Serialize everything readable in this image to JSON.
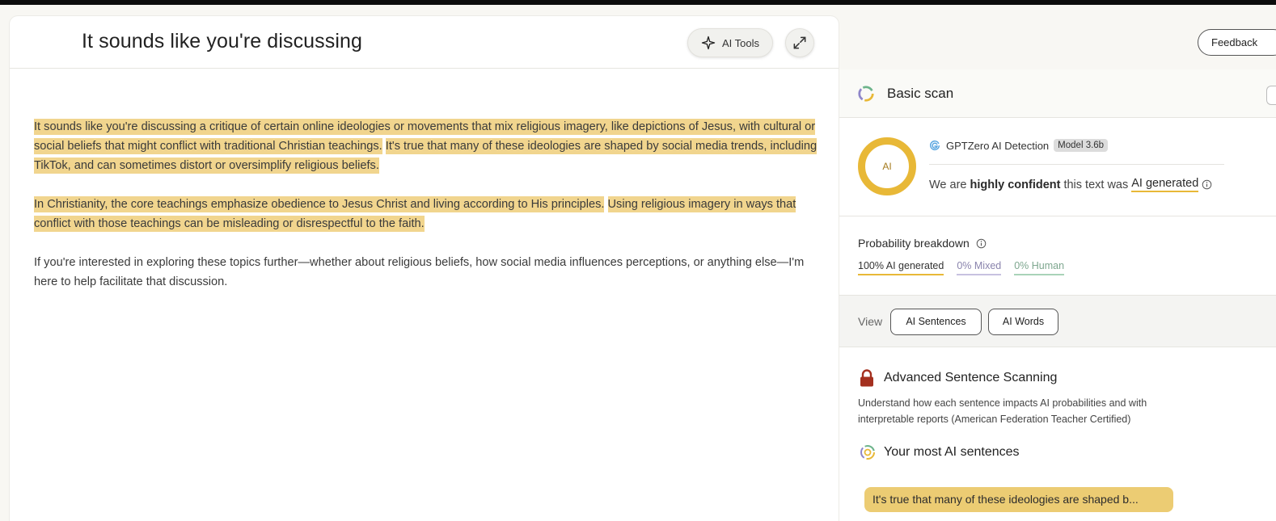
{
  "editor": {
    "title": "It sounds like you're discussing",
    "ai_tools_label": "AI Tools",
    "paragraphs": [
      {
        "s1": "It sounds like you're discussing a critique of certain online ideologies or movements that mix religious imagery, like depictions of Jesus, with cultural or social beliefs that might conflict with traditional Christian teachings.",
        "s2": "It's true that many of these ideologies are shaped by social media trends, including TikTok, and can sometimes distort or oversimplify religious beliefs."
      },
      {
        "s1": "In Christianity, the core teachings emphasize obedience to Jesus Christ and living according to His principles.",
        "s2": "Using religious imagery in ways that conflict with those teachings can be misleading or disrespectful to the faith."
      },
      {
        "s1": "If you're interested in exploring these topics further—whether about religious beliefs, how social media influences perceptions, or anything else—I'm here to help facilitate that discussion."
      }
    ]
  },
  "panel": {
    "feedback_label": "Feedback",
    "scan_title": "Basic scan",
    "ring_label": "AI",
    "detector_name": "GPTZero AI Detection",
    "model_badge": "Model 3.6b",
    "confidence": {
      "prefix": "We are",
      "level": "highly confident",
      "middle": "this text was",
      "verdict": "AI generated"
    },
    "probability": {
      "title": "Probability breakdown",
      "ai": "100% AI generated",
      "mixed": "0% Mixed",
      "human": "0% Human"
    },
    "view": {
      "label": "View",
      "btn_sentences": "AI Sentences",
      "btn_words": "AI Words"
    },
    "advanced": {
      "title": "Advanced Sentence Scanning",
      "description": "Understand how each sentence impacts AI probabilities and with interpretable reports (American Federation Teacher Certified)"
    },
    "most_ai": {
      "title": "Your most AI sentences",
      "sentence": "It's true that many of these ideologies are shaped b..."
    }
  },
  "colors": {
    "highlight": "#f1d58e",
    "accent": "#e8b837",
    "mixed": "#c7c2e0",
    "human": "#a9d3b8",
    "lock": "#a4301f"
  }
}
